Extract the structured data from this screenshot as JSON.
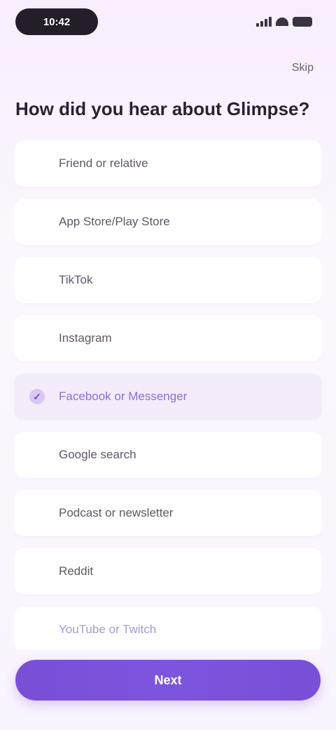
{
  "status_bar": {
    "time": "10:42",
    "icons": [
      "signal-icon",
      "wifi-icon",
      "battery-icon"
    ]
  },
  "header": {
    "skip_label": "Skip",
    "title": "How did you hear about Glimpse?"
  },
  "options": [
    {
      "label": "Friend or relative",
      "selected": false
    },
    {
      "label": "App Store/Play Store",
      "selected": false
    },
    {
      "label": "TikTok",
      "selected": false
    },
    {
      "label": "Instagram",
      "selected": false
    },
    {
      "label": "Facebook or Messenger",
      "selected": true
    },
    {
      "label": "Google search",
      "selected": false
    },
    {
      "label": "Podcast or newsletter",
      "selected": false
    },
    {
      "label": "Reddit",
      "selected": false
    },
    {
      "label": "YouTube or Twitch",
      "selected": false
    }
  ],
  "footer": {
    "continue_label": "Next"
  },
  "colors": {
    "accent": "#7a4fd8",
    "selected_bg": "#f4ebfb",
    "background": "#faf4fe"
  }
}
